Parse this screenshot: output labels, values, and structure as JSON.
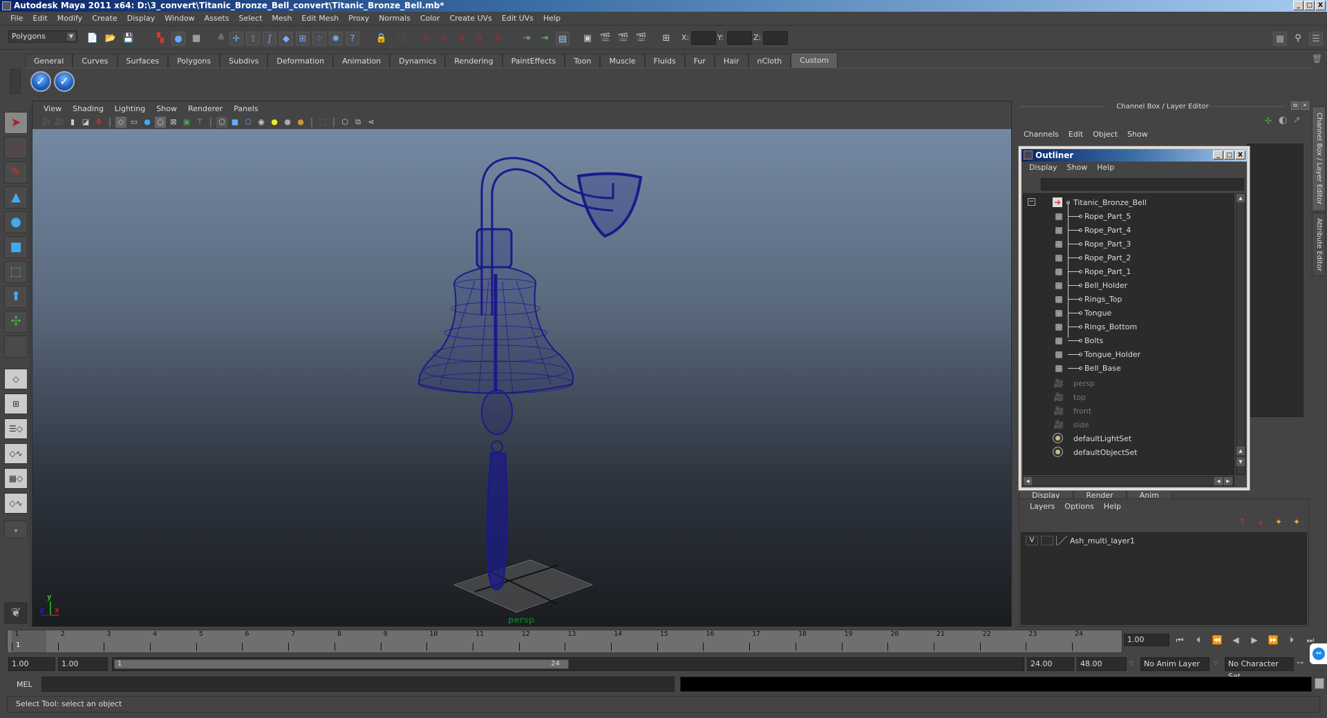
{
  "window": {
    "title": "Autodesk Maya 2011 x64: D:\\3_convert\\Titanic_Bronze_Bell_convert\\Titanic_Bronze_Bell.mb*",
    "controls": [
      "minimize",
      "maximize",
      "close"
    ]
  },
  "menubar": [
    "File",
    "Edit",
    "Modify",
    "Create",
    "Display",
    "Window",
    "Assets",
    "Select",
    "Mesh",
    "Edit Mesh",
    "Proxy",
    "Normals",
    "Color",
    "Create UVs",
    "Edit UVs",
    "Help"
  ],
  "statusline": {
    "mode": "Polygons",
    "xyz_labels": {
      "x": "X:",
      "y": "Y:",
      "z": "Z:"
    },
    "x_value": "",
    "y_value": "",
    "z_value": ""
  },
  "shelf": {
    "tabs": [
      "General",
      "Curves",
      "Surfaces",
      "Polygons",
      "Subdivs",
      "Deformation",
      "Animation",
      "Dynamics",
      "Rendering",
      "PaintEffects",
      "Toon",
      "Muscle",
      "Fluids",
      "Fur",
      "Hair",
      "nCloth",
      "Custom"
    ],
    "active_tab": "Custom",
    "icons": [
      "checkmark-icon",
      "checkmark-icon"
    ]
  },
  "viewport": {
    "menu": [
      "View",
      "Shading",
      "Lighting",
      "Show",
      "Renderer",
      "Panels"
    ],
    "camera": "persp",
    "axes": {
      "x": "x",
      "y": "y",
      "z": "z"
    },
    "wire_color": "#1a1a8a"
  },
  "channel_box": {
    "title": "Channel Box / Layer Editor",
    "menu": [
      "Channels",
      "Edit",
      "Object",
      "Show"
    ]
  },
  "side_tabs": [
    "Channel Box / Layer Editor",
    "Attribute Editor"
  ],
  "outliner": {
    "title": "Outliner",
    "menu": [
      "Display",
      "Show",
      "Help"
    ],
    "root": "Titanic_Bronze_Bell",
    "children": [
      "Rope_Part_5",
      "Rope_Part_4",
      "Rope_Part_3",
      "Rope_Part_2",
      "Rope_Part_1",
      "Bell_Holder",
      "Rings_Top",
      "Tongue",
      "Rings_Bottom",
      "Bolts",
      "Tongue_Holder",
      "Bell_Base"
    ],
    "cameras": [
      "persp",
      "top",
      "front",
      "side"
    ],
    "sets": [
      "defaultLightSet",
      "defaultObjectSet"
    ]
  },
  "layer_editor": {
    "tabs": [
      "Display",
      "Render",
      "Anim"
    ],
    "menu": [
      "Layers",
      "Options",
      "Help"
    ],
    "layers": [
      {
        "visible": "V",
        "name": "Ash_multi_layer1"
      }
    ]
  },
  "timeline": {
    "start": 1,
    "end": 24,
    "current_frame": "1",
    "current_time": "1.00",
    "ticks": [
      "1",
      "2",
      "3",
      "4",
      "5",
      "6",
      "7",
      "8",
      "9",
      "10",
      "11",
      "12",
      "13",
      "14",
      "15",
      "16",
      "17",
      "18",
      "19",
      "20",
      "21",
      "22",
      "23",
      "24"
    ]
  },
  "range": {
    "anim_start": "1.00",
    "playback_start": "1.00",
    "handle_start": "1",
    "handle_end": "24",
    "playback_end": "24.00",
    "anim_end": "48.00",
    "anim_layer": "No Anim Layer",
    "character_set": "No Character Set"
  },
  "command_line": {
    "label": "MEL",
    "value": ""
  },
  "help_line": "Select Tool: select an object"
}
